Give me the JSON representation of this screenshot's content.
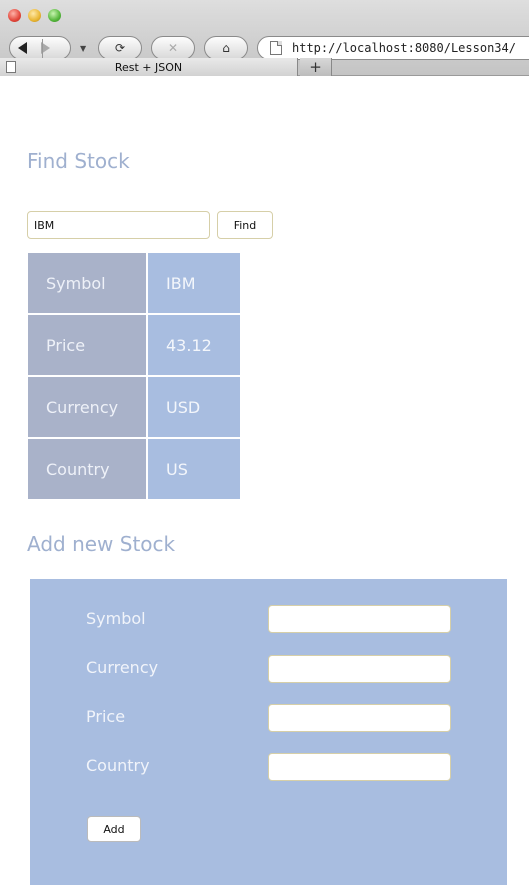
{
  "browser": {
    "url": "http://localhost:8080/Lesson34/",
    "tab_title": "Rest + JSON",
    "new_tab_label": "+"
  },
  "find_section": {
    "title": "Find Stock",
    "search_value": "IBM",
    "find_label": "Find"
  },
  "result_table": {
    "rows": [
      {
        "label": "Symbol",
        "value": "IBM"
      },
      {
        "label": "Price",
        "value": "43.12"
      },
      {
        "label": "Currency",
        "value": "USD"
      },
      {
        "label": "Country",
        "value": "US"
      }
    ]
  },
  "add_section": {
    "title": "Add new Stock",
    "fields": [
      {
        "label": "Symbol",
        "value": ""
      },
      {
        "label": "Currency",
        "value": ""
      },
      {
        "label": "Price",
        "value": ""
      },
      {
        "label": "Country",
        "value": ""
      }
    ],
    "add_label": "Add"
  },
  "colors": {
    "title": "#9fb0cf",
    "label_cell": "#a9b2c9",
    "value_cell": "#a8bde0",
    "panel": "#a8bde0"
  }
}
